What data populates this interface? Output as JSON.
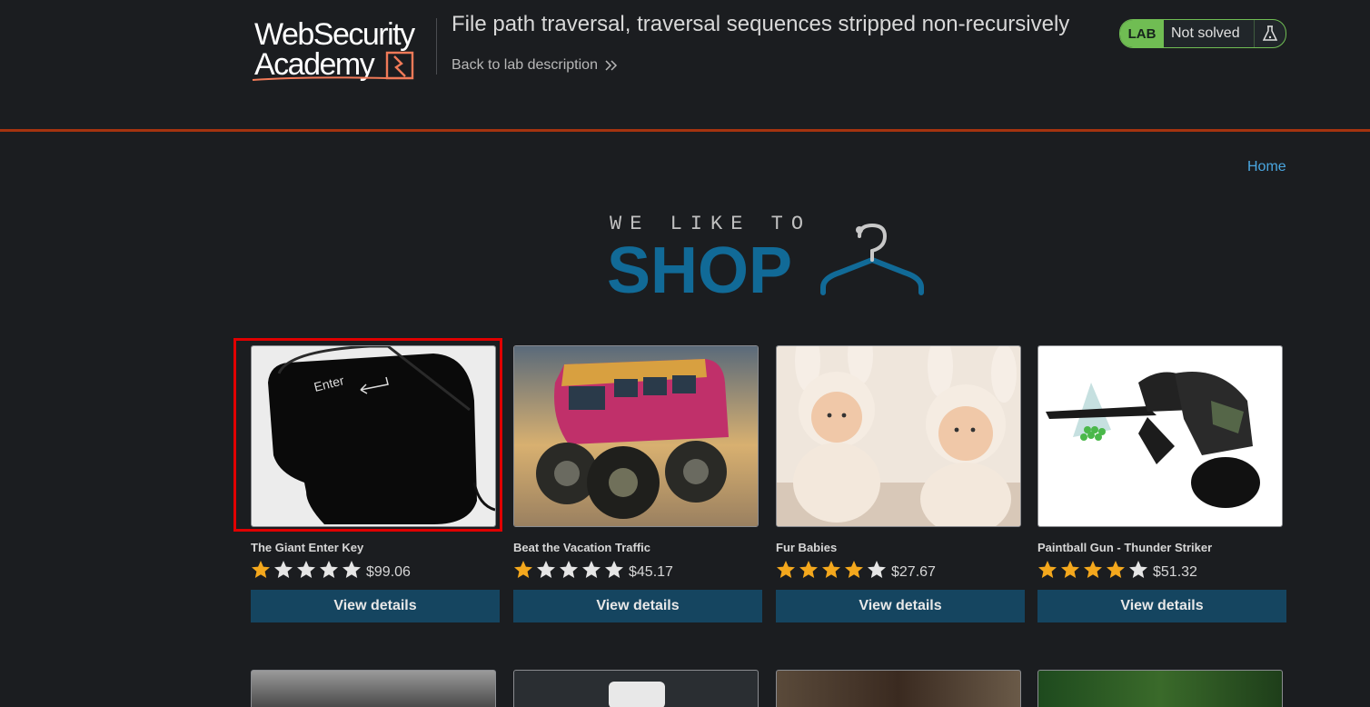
{
  "header": {
    "logo_line1": "WebSecurity",
    "logo_line2": "Academy",
    "lab_title": "File path traversal, traversal sequences stripped non-recursively",
    "back_link": "Back to lab description",
    "lab_badge": "LAB",
    "lab_status": "Not solved"
  },
  "nav": {
    "home": "Home"
  },
  "banner": {
    "tagline": "WE LIKE TO",
    "word": "SHOP"
  },
  "products": [
    {
      "name": "The Giant Enter Key",
      "rating": 1,
      "price": "$99.06",
      "button": "View details",
      "image": "giant-enter-key-image"
    },
    {
      "name": "Beat the Vacation Traffic",
      "rating": 1,
      "price": "$45.17",
      "button": "View details",
      "image": "monster-van-image"
    },
    {
      "name": "Fur Babies",
      "rating": 4,
      "price": "$27.67",
      "button": "View details",
      "image": "fur-babies-image"
    },
    {
      "name": "Paintball Gun - Thunder Striker",
      "rating": 4,
      "price": "$51.32",
      "button": "View details",
      "image": "paintball-gun-image"
    }
  ],
  "colors": {
    "background": "#1b1d20",
    "accent_line": "#a5330f",
    "lab_green": "#70bd53",
    "link_blue": "#4aa6e0",
    "button": "#154560",
    "shop_blue": "#116a97",
    "star_gold": "#f4a81d",
    "highlight": "#e00000"
  }
}
